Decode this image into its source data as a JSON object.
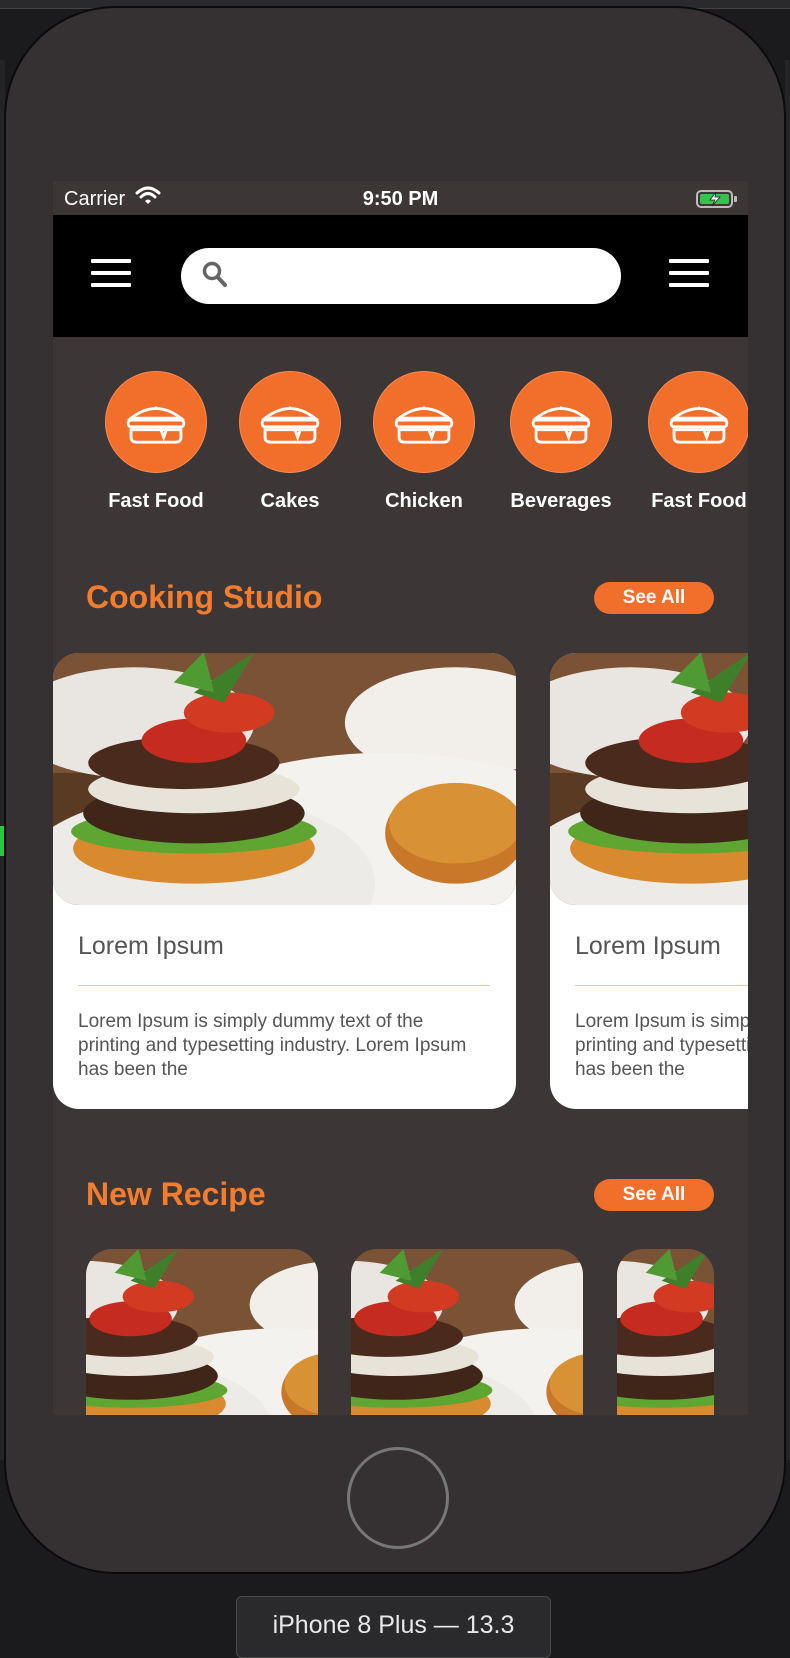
{
  "status_bar": {
    "carrier": "Carrier",
    "time": "9:50 PM"
  },
  "search": {
    "placeholder": ""
  },
  "categories": [
    {
      "label": "Fast Food",
      "icon": "burger-icon"
    },
    {
      "label": "Cakes",
      "icon": "burger-icon"
    },
    {
      "label": "Chicken",
      "icon": "burger-icon"
    },
    {
      "label": "Beverages",
      "icon": "burger-icon"
    },
    {
      "label": "Fast Food",
      "icon": "burger-icon"
    }
  ],
  "cooking_studio": {
    "title": "Cooking Studio",
    "see_all": "See All",
    "cards": [
      {
        "title": "Lorem Ipsum",
        "description": "Lorem Ipsum is simply dummy text of the printing and typesetting industry. Lorem Ipsum has been the"
      },
      {
        "title": "Lorem Ipsum",
        "description": "Lorem Ipsum is simply dummy text of the printing and typesetting industry. Lorem Ipsum has been the"
      }
    ]
  },
  "new_recipe": {
    "title": "New Recipe",
    "see_all": "See All"
  },
  "simulator": {
    "device_label": "iPhone 8 Plus — 13.3"
  },
  "colors": {
    "accent": "#f26e2b",
    "screen_bg": "#3c3637",
    "navbar_bg": "#000000"
  }
}
